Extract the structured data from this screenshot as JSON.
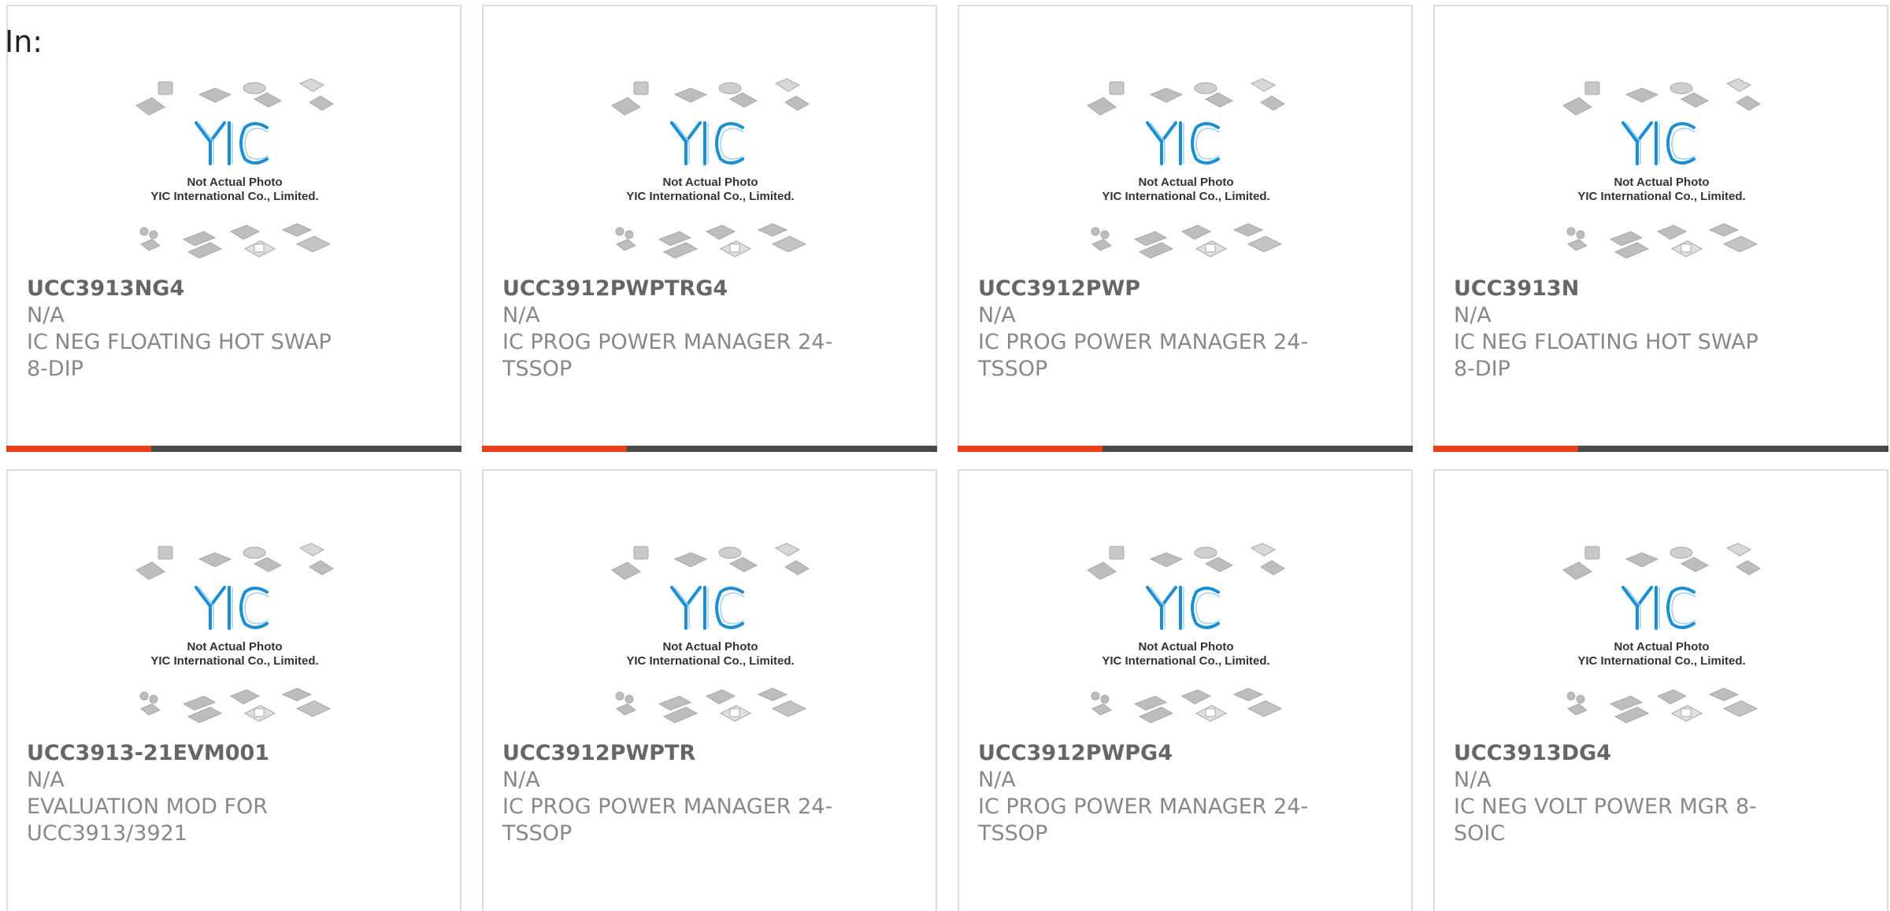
{
  "header": {
    "label": "In:"
  },
  "placeholder": {
    "line1": "Not Actual Photo",
    "line2": "YIC International Co., Limited.",
    "brand": "YIC"
  },
  "colors": {
    "accent": "#e8401c",
    "bar": "#4a4a4a",
    "border": "#dcdcdc",
    "logo": "#1b8fd1"
  },
  "products": [
    {
      "part": "UCC3913NG4",
      "mfr": "N/A",
      "desc": "IC NEG FLOATING HOT SWAP 8-DIP"
    },
    {
      "part": "UCC3912PWPTRG4",
      "mfr": "N/A",
      "desc": "IC PROG POWER MANAGER 24-TSSOP"
    },
    {
      "part": "UCC3912PWP",
      "mfr": "N/A",
      "desc": "IC PROG POWER MANAGER 24-TSSOP"
    },
    {
      "part": "UCC3913N",
      "mfr": "N/A",
      "desc": "IC NEG FLOATING HOT SWAP 8-DIP"
    },
    {
      "part": "UCC3913-21EVM001",
      "mfr": "N/A",
      "desc": "EVALUATION MOD FOR UCC3913/3921"
    },
    {
      "part": "UCC3912PWPTR",
      "mfr": "N/A",
      "desc": "IC PROG POWER MANAGER 24-TSSOP"
    },
    {
      "part": "UCC3912PWPG4",
      "mfr": "N/A",
      "desc": "IC PROG POWER MANAGER 24-TSSOP"
    },
    {
      "part": "UCC3913DG4",
      "mfr": "N/A",
      "desc": "IC NEG VOLT POWER MGR 8-SOIC"
    }
  ]
}
